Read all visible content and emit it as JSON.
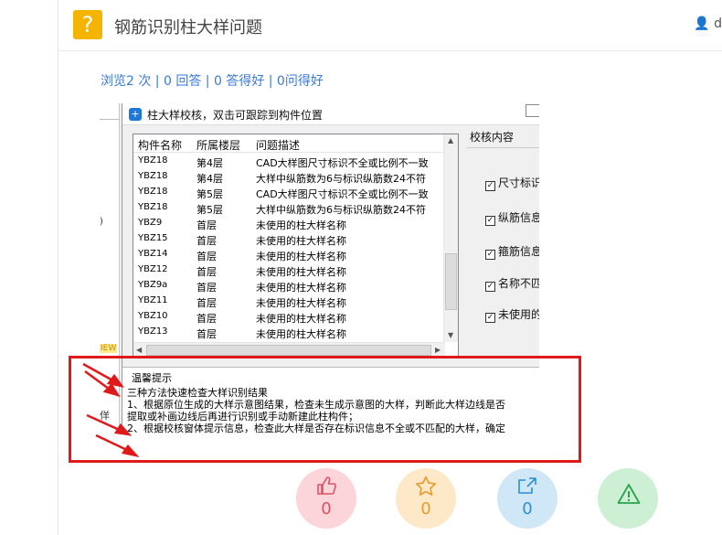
{
  "header": {
    "badge": "?",
    "title": "钢筋识别柱大样问题",
    "user": "d"
  },
  "stats": "浏览2 次 | 0 回答 | 0 答得好 | 0问得好",
  "screenshot": {
    "left_marks": {
      "m1": ")",
      "m2": "IEW",
      "m3": "佯"
    },
    "window": {
      "title": "柱大样校核，双击可跟踪到构件位置",
      "columns": [
        "构件名称",
        "所属楼层",
        "问题描述"
      ],
      "rows": [
        [
          "YBZ18",
          "第4层",
          "CAD大样图尺寸标识不全或比例不一致"
        ],
        [
          "YBZ18",
          "第4层",
          "大样中纵筋数为6与标识纵筋数24不符"
        ],
        [
          "YBZ18",
          "第5层",
          "CAD大样图尺寸标识不全或比例不一致"
        ],
        [
          "YBZ18",
          "第5层",
          "大样中纵筋数为6与标识纵筋数24不符"
        ],
        [
          "YBZ9",
          "首层",
          "未使用的柱大样名称"
        ],
        [
          "YBZ15",
          "首层",
          "未使用的柱大样名称"
        ],
        [
          "YBZ14",
          "首层",
          "未使用的柱大样名称"
        ],
        [
          "YBZ12",
          "首层",
          "未使用的柱大样名称"
        ],
        [
          "YBZ9a",
          "首层",
          "未使用的柱大样名称"
        ],
        [
          "YBZ11",
          "首层",
          "未使用的柱大样名称"
        ],
        [
          "YBZ10",
          "首层",
          "未使用的柱大样名称"
        ],
        [
          "YBZ13",
          "首层",
          "未使用的柱大样名称"
        ]
      ],
      "check_title": "校核内容",
      "checks": [
        "尺寸标识",
        "纵筋信息",
        "箍筋信息",
        "名称不匹",
        "未使用的"
      ],
      "tips": {
        "title": "温馨提示",
        "line1": "三种方法快速检查大样识别结果",
        "line2": "1、根据原位生成的大样示意图结果，检查未生成示意图的大样，判断此大样边线是否",
        "line3": "  提取或补画边线后再进行识别或手动新建此柱构件；",
        "line4": "2、根据校核窗体提示信息，检查此大样是否存在标识信息不全或不匹配的大样，确定"
      }
    }
  },
  "actions": {
    "like": "0",
    "favorite": "0",
    "share": "0"
  },
  "colors": {
    "badge": "#f5b400",
    "link": "#3a7ad9",
    "highlight": "#e01a1a"
  }
}
